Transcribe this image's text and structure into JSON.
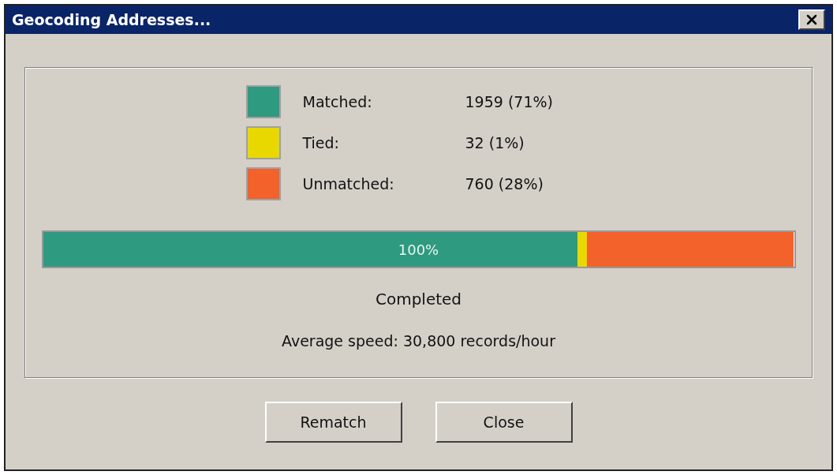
{
  "window": {
    "title": "Geocoding Addresses..."
  },
  "legend": [
    {
      "label": "Matched:",
      "value": "1959 (71%)",
      "color": "#2e9a80"
    },
    {
      "label": "Tied:",
      "value": "32 (1%)",
      "color": "#e8d800"
    },
    {
      "label": "Unmatched:",
      "value": "760 (28%)",
      "color": "#f2622a"
    }
  ],
  "progress": {
    "label": "100%",
    "segments": [
      {
        "level": 0.712,
        "color": "#2e9a80"
      },
      {
        "level": 0.012,
        "color": "#e8d800"
      },
      {
        "level": 0.276,
        "color": "#f2622a"
      }
    ]
  },
  "status": "Completed",
  "speed": "Average speed: 30,800 records/hour",
  "buttons": [
    "Rematch",
    "Close"
  ]
}
